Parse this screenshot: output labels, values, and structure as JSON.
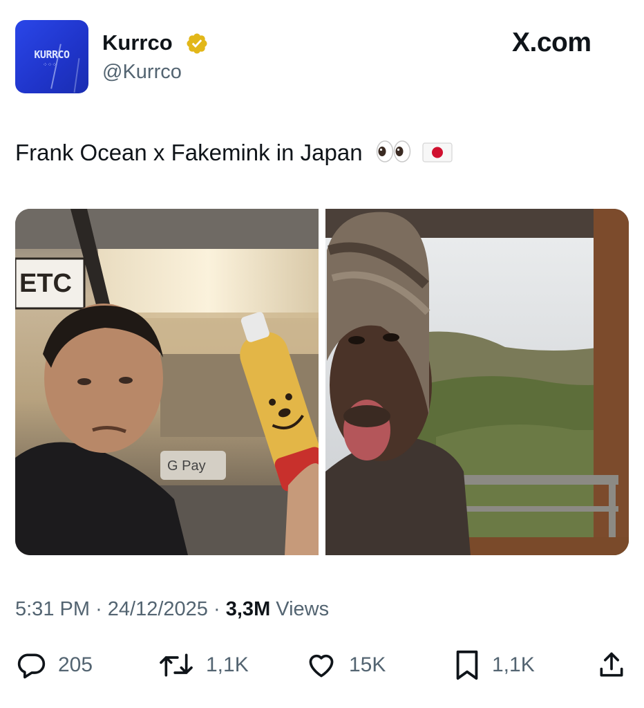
{
  "source_label": "X.com",
  "author": {
    "display_name": "Kurrco",
    "handle": "@Kurrco",
    "verified": true,
    "avatar_text": "KURRCO"
  },
  "tweet": {
    "text": "Frank Ocean x Fakemink in Japan",
    "emojis": [
      "eyes-emoji",
      "japan-flag-emoji"
    ]
  },
  "meta": {
    "time": "5:31 PM",
    "date": "24/12/2025",
    "views_count": "3,3M",
    "views_label": "Views",
    "separator": "·"
  },
  "actions": {
    "replies": "205",
    "reposts": "1,1K",
    "likes": "15K",
    "bookmarks": "1,1K"
  },
  "photo_signs": {
    "left_sign": "ETC",
    "left_gpay": "G Pay"
  },
  "colors": {
    "text_primary": "#0f1419",
    "text_secondary": "#536471",
    "verified_gold": "#e2b719",
    "avatar_blue": "#2a46e8"
  }
}
